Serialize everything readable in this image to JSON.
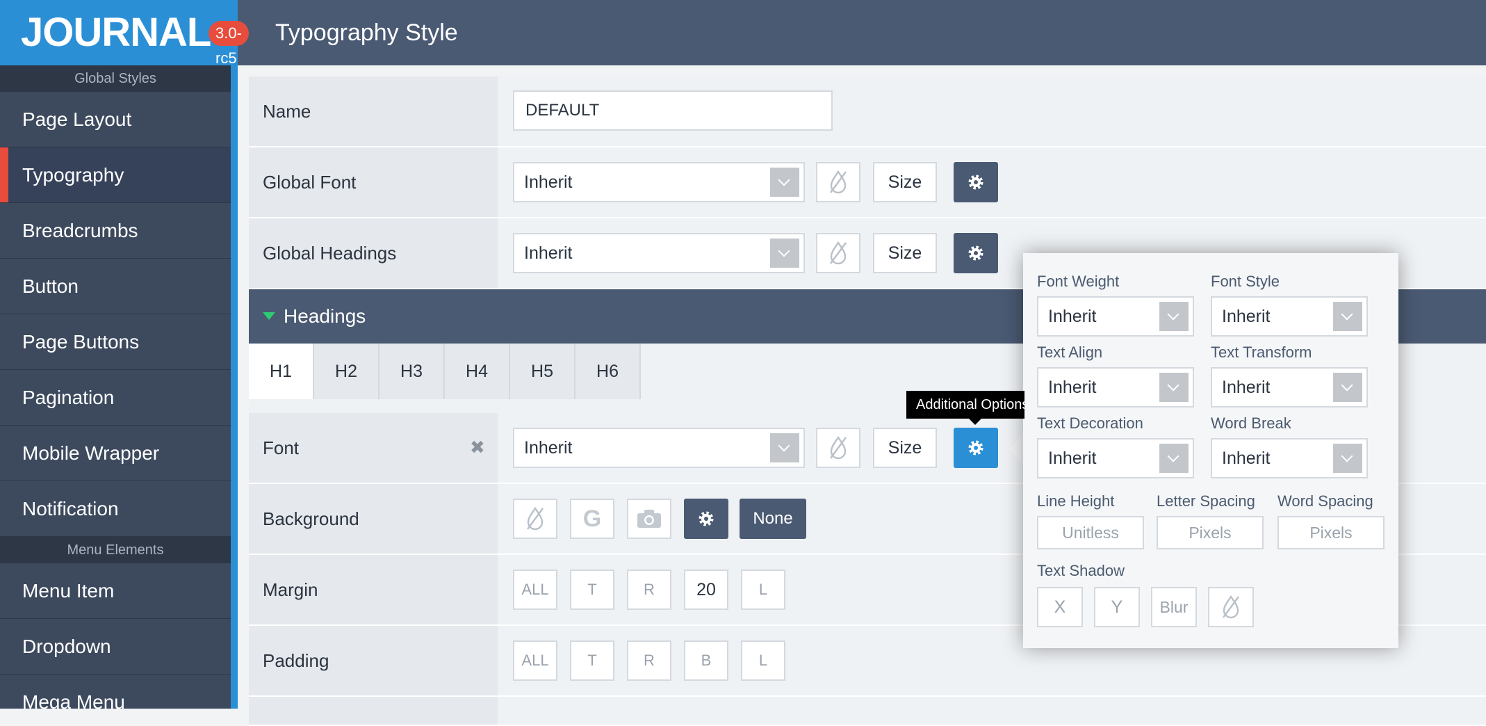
{
  "header": {
    "logo": "JOURNAL",
    "version": "3.0-rc5",
    "title": "Typography Style"
  },
  "sidebar": {
    "section1": "Global Styles",
    "items1": [
      "Page Layout",
      "Typography",
      "Breadcrumbs",
      "Button",
      "Page Buttons",
      "Pagination",
      "Mobile Wrapper",
      "Notification"
    ],
    "active_item": "Typography",
    "section2": "Menu Elements",
    "items2": [
      "Menu Item",
      "Dropdown",
      "Mega Menu"
    ]
  },
  "form": {
    "name_label": "Name",
    "name_value": "DEFAULT",
    "global_font_label": "Global Font",
    "global_font_value": "Inherit",
    "global_headings_label": "Global Headings",
    "global_headings_value": "Inherit",
    "size_label": "Size",
    "headings_section": "Headings",
    "tabs": [
      "H1",
      "H2",
      "H3",
      "H4",
      "H5",
      "H6"
    ],
    "active_tab": "H1",
    "font_label": "Font",
    "font_value": "Inherit",
    "background_label": "Background",
    "background_g": "G",
    "background_none": "None",
    "margin_label": "Margin",
    "margin_values": [
      "ALL",
      "T",
      "R",
      "20",
      "L"
    ],
    "padding_label": "Padding",
    "padding_values": [
      "ALL",
      "T",
      "R",
      "B",
      "L"
    ]
  },
  "tooltip": "Additional Options",
  "popover": {
    "font_weight_label": "Font Weight",
    "font_weight_value": "Inherit",
    "font_style_label": "Font Style",
    "font_style_value": "Inherit",
    "text_align_label": "Text Align",
    "text_align_value": "Inherit",
    "text_transform_label": "Text Transform",
    "text_transform_value": "Inherit",
    "text_decoration_label": "Text Decoration",
    "text_decoration_value": "Inherit",
    "word_break_label": "Word Break",
    "word_break_value": "Inherit",
    "line_height_label": "Line Height",
    "line_height_placeholder": "Unitless",
    "letter_spacing_label": "Letter Spacing",
    "letter_spacing_placeholder": "Pixels",
    "word_spacing_label": "Word Spacing",
    "word_spacing_placeholder": "Pixels",
    "text_shadow_label": "Text Shadow",
    "shadow_x": "X",
    "shadow_y": "Y",
    "shadow_blur": "Blur"
  },
  "colors": {
    "header_bg": "#4a5a73",
    "logo_bg": "#2b8fd6",
    "accent_red": "#e74c3c",
    "active_gear": "#2b8fd6"
  }
}
